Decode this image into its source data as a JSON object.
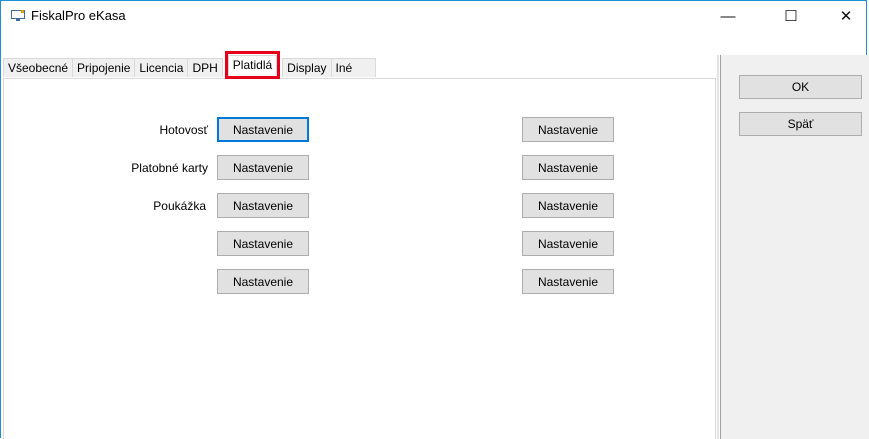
{
  "window": {
    "title": "FiskalPro eKasa",
    "icon": "monitor-icon",
    "controls": {
      "minimize": "—",
      "maximize": "☐",
      "close": "✕"
    }
  },
  "tabs": [
    {
      "label": "Všeobecné",
      "active": false
    },
    {
      "label": "Pripojenie",
      "active": false
    },
    {
      "label": "Licencia",
      "active": false
    },
    {
      "label": "DPH",
      "active": false
    },
    {
      "label": "Platidlá",
      "active": true
    },
    {
      "label": "Display",
      "active": false
    },
    {
      "label": "Iné",
      "active": false
    }
  ],
  "payments": {
    "rows": [
      {
        "label": "Hotovosť",
        "left_button": "Nastavenie",
        "right_button": "Nastavenie",
        "left_focused": true
      },
      {
        "label": "Platobné karty",
        "left_button": "Nastavenie",
        "right_button": "Nastavenie"
      },
      {
        "label": "Poukážka",
        "left_button": "Nastavenie",
        "right_button": "Nastavenie"
      },
      {
        "label": "",
        "left_button": "Nastavenie",
        "right_button": "Nastavenie"
      },
      {
        "label": "",
        "left_button": "Nastavenie",
        "right_button": "Nastavenie"
      }
    ]
  },
  "actions": {
    "ok": "OK",
    "back": "Späť"
  },
  "colors": {
    "highlight": "#e6001a",
    "focus": "#0078d7",
    "window_border": "#1e90d6"
  }
}
